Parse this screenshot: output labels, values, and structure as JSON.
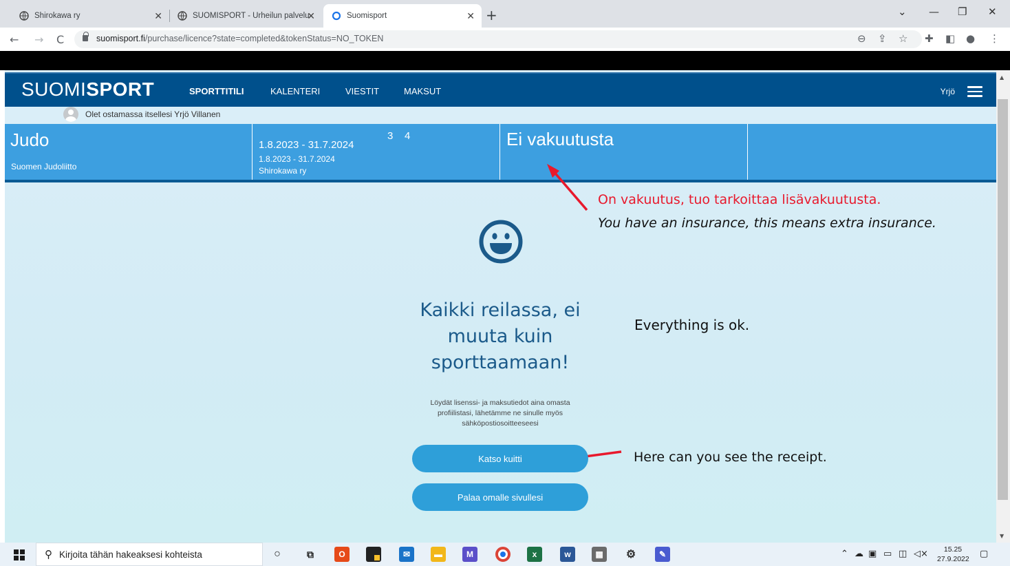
{
  "browser": {
    "tabs": [
      {
        "label": "Shirokawa ry",
        "active": false
      },
      {
        "label": "SUOMISPORT - Urheilun palvelut",
        "active": false
      },
      {
        "label": "Suomisport",
        "active": true
      }
    ],
    "url_host": "suomisport.fi",
    "url_path": "/purchase/licence?state=completed&tokenStatus=NO_TOKEN"
  },
  "site": {
    "logo_light": "SUOMI",
    "logo_bold": "SPORT",
    "nav": [
      "SPORTTITILI",
      "KALENTERI",
      "VIESTIT",
      "MAKSUT"
    ],
    "user": "Yrjö"
  },
  "buyer_text": "Olet ostamassa itsellesi Yrjö Villanen",
  "licence": {
    "sport": "Judo",
    "federation": "Suomen Judoliitto",
    "period_main": "1.8.2023 - 31.7.2024",
    "period_small": "1.8.2023 - 31.7.2024",
    "club": "Shirokawa ry",
    "num_a": "3",
    "num_b": "4",
    "insurance": "Ei vakuutusta"
  },
  "annotations": {
    "insurance_fi": "On vakuutus, tuo tarkoittaa lisävakuutusta.",
    "insurance_en": "You have an insurance, this means extra insurance.",
    "ok": "Everything is ok.",
    "receipt": "Here can you see the receipt."
  },
  "success": {
    "heading_1": "Kaikki reilassa, ei",
    "heading_2": "muuta kuin",
    "heading_3": "sporttaamaan!",
    "info_1": "Löydät lisenssi- ja maksutiedot aina omasta",
    "info_2": "profiilistasi, lähetämme ne sinulle myös",
    "info_3": "sähköpostiosoitteeseesi",
    "btn_receipt": "Katso kuitti",
    "btn_home": "Palaa omalle sivullesi"
  },
  "taskbar": {
    "search_placeholder": "Kirjoita tähän hakeaksesi kohteista",
    "time": "15.25",
    "date": "27.9.2022"
  },
  "colors": {
    "nav_bg": "#00508c",
    "card_bg": "#3d9fe0",
    "button_bg": "#2e9fd9",
    "annotation_red": "#e8192c"
  }
}
